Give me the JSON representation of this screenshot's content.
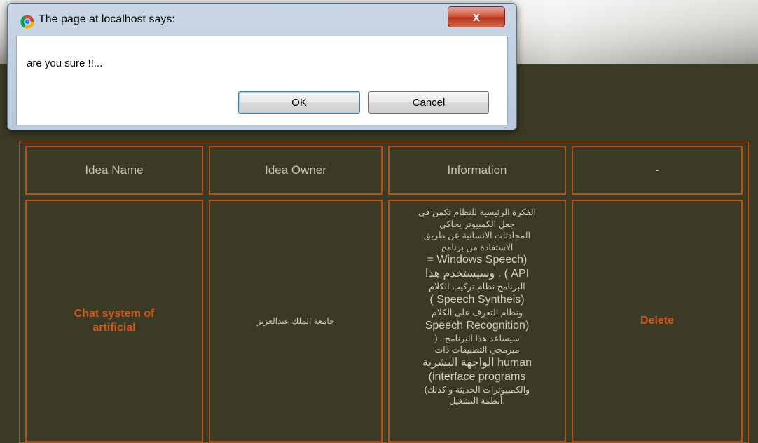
{
  "dialog": {
    "title": "The page at localhost says:",
    "message": "are you sure !!...",
    "ok_label": "OK",
    "cancel_label": "Cancel",
    "close_label": "x"
  },
  "table": {
    "headers": [
      "Idea Name",
      "Idea Owner",
      "Information",
      "-"
    ],
    "rows": [
      {
        "name_line1": "Chat system of",
        "name_line2": "artificial",
        "owner": "جامعة الملك عبدالعزيز",
        "info_lines": [
          "الفكرة الرئيسية للنظام تكمن في",
          "جعل الكمبيوتر يحاكي",
          "المحادثات الانسانية عن طريق",
          "الاستفادة من برنامج",
          "(Windows Speech =",
          "API ) . وسيستخدم هذا",
          "البرنامج نظام تركيب الكلام",
          "(Speech Syntheis )",
          "ونظام التعرف على الكلام",
          "(Speech Recognition",
          "سيساعد هذا البرنامج . (",
          "مبرمجي التطبيقات ذات",
          "human الواجهة البشرية",
          "interface programs)",
          "والكمبيوترات الحديثة و كذلك)",
          ".أنظمة التشغيل"
        ],
        "action": "Delete"
      }
    ]
  },
  "colors": {
    "background": "#3b3a24",
    "border": "#b5501e",
    "accent_text": "#d2561a",
    "header_text": "#c9c2ae"
  }
}
